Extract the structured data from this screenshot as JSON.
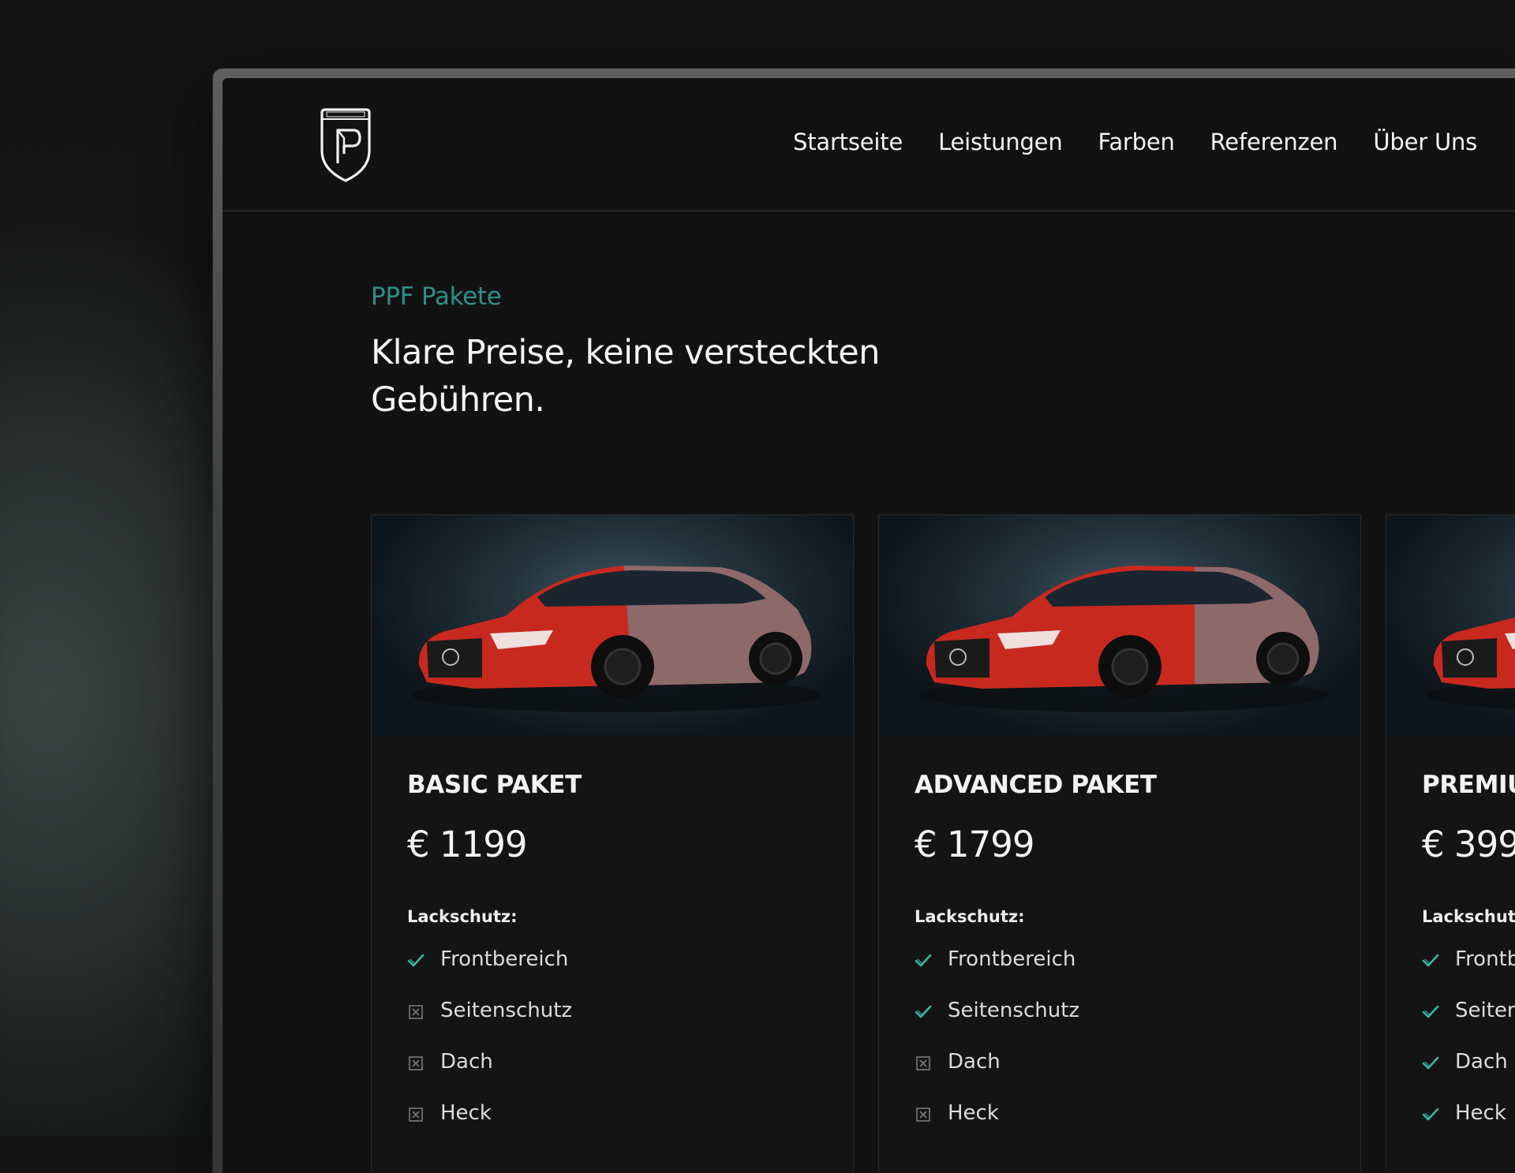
{
  "nav": {
    "items": [
      "Startseite",
      "Leistungen",
      "Farben",
      "Referenzen",
      "Über Uns"
    ]
  },
  "hero": {
    "eyebrow": "PPF Pakete",
    "headline_line1": "Klare Preise, keine versteckten",
    "headline_line2": "Gebühren."
  },
  "colors": {
    "accent": "#2f8f86",
    "check": "#3bb7a3",
    "background": "#121212"
  },
  "cards": [
    {
      "title": "BASIC PAKET",
      "price": "€ 1199",
      "section": "Lackschutz:",
      "features": [
        {
          "label": "Frontbereich",
          "included": true
        },
        {
          "label": "Seitenschutz",
          "included": false
        },
        {
          "label": "Dach",
          "included": false
        },
        {
          "label": "Heck",
          "included": false
        }
      ]
    },
    {
      "title": "ADVANCED PAKET",
      "price": "€ 1799",
      "section": "Lackschutz:",
      "features": [
        {
          "label": "Frontbereich",
          "included": true
        },
        {
          "label": "Seitenschutz",
          "included": true
        },
        {
          "label": "Dach",
          "included": false
        },
        {
          "label": "Heck",
          "included": false
        }
      ]
    },
    {
      "title": "PREMIU",
      "price": "€ 399",
      "section": "Lackschut",
      "features": [
        {
          "label": "Frontb",
          "included": true
        },
        {
          "label": "Seiten",
          "included": true
        },
        {
          "label": "Dach",
          "included": true
        },
        {
          "label": "Heck",
          "included": true
        }
      ]
    }
  ]
}
